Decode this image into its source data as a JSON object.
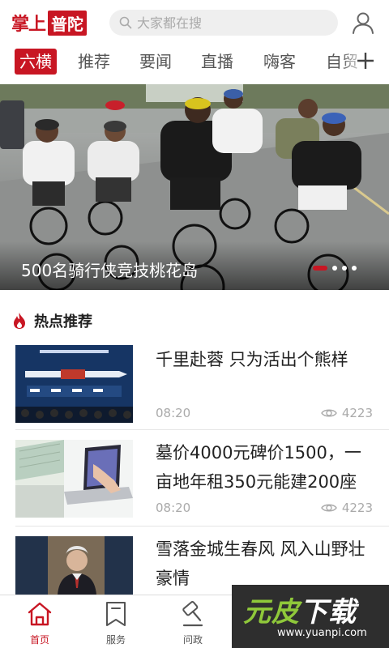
{
  "header": {
    "logo_part1": "掌上",
    "logo_part2": "普陀",
    "search_placeholder": "大家都在搜"
  },
  "tabs": [
    {
      "label": "六横",
      "active": true
    },
    {
      "label": "推荐"
    },
    {
      "label": "要闻"
    },
    {
      "label": "直播"
    },
    {
      "label": "嗨客"
    },
    {
      "label": "自贸"
    }
  ],
  "banner": {
    "caption": "500名骑行侠竞技桃花岛",
    "slide_count": 4,
    "active_slide": 1
  },
  "section": {
    "title": "热点推荐"
  },
  "news": [
    {
      "title": "千里赴蓉 只为活出个熊样",
      "time": "08:20",
      "views": "4223"
    },
    {
      "title": "墓价4000元碑价1500，一亩地年租350元能建200座",
      "time": "08:20",
      "views": "4223"
    },
    {
      "title": "雪落金城生春风  风入山野壮豪情",
      "time": "",
      "views": ""
    }
  ],
  "bottom_nav": [
    {
      "label": "首页",
      "icon": "home-icon",
      "active": true
    },
    {
      "label": "服务",
      "icon": "bookmark-icon"
    },
    {
      "label": "问政",
      "icon": "gavel-icon"
    }
  ],
  "watermark": {
    "text_a": "元皮",
    "text_b": "下载",
    "url": "www.yuanpi.com"
  },
  "colors": {
    "accent": "#c81623",
    "muted": "#aaaaaa",
    "watermark_green": "#8fc83a"
  }
}
